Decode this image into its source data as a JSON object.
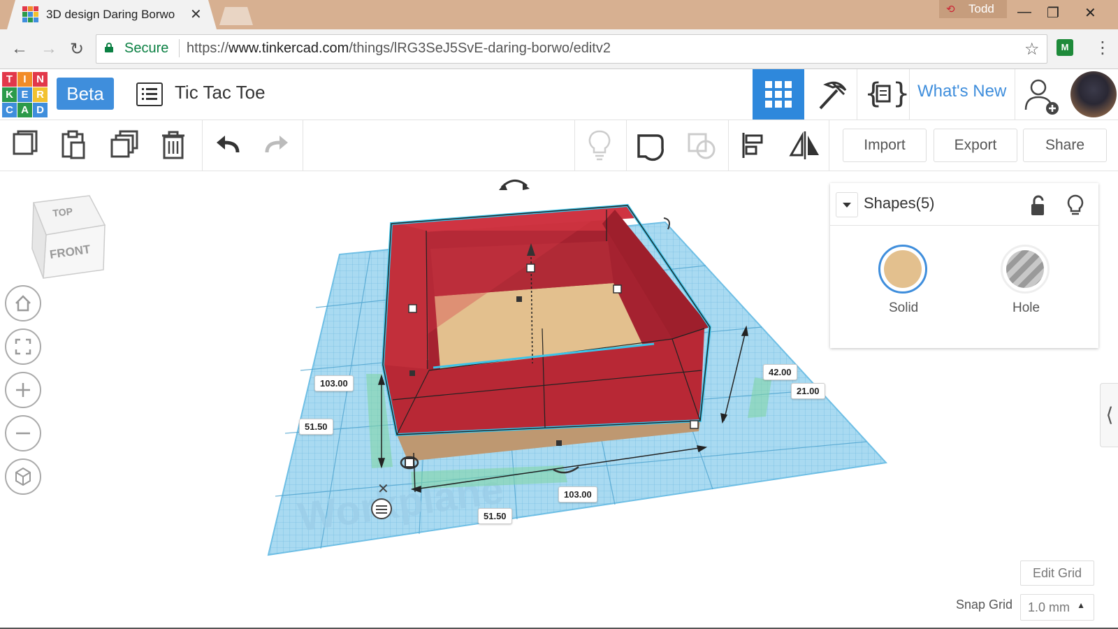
{
  "browser": {
    "tab_title": "3D design Daring Borwo",
    "tab_close": "✕",
    "profile_name": "Todd",
    "window_controls": {
      "minimize": "—",
      "restore": "❐",
      "close": "✕"
    },
    "secure_label": "Secure",
    "url_prefix": "https://",
    "url_host": "www.tinkercad.com",
    "url_path": "/things/lRG3SeJ5SvE-daring-borwo/editv2"
  },
  "app": {
    "logo_letters": [
      "T",
      "I",
      "N",
      "K",
      "E",
      "R",
      "C",
      "A",
      "D"
    ],
    "beta_label": "Beta",
    "design_title": "Tic Tac Toe",
    "whats_new": "What's New"
  },
  "toolbar": {
    "import_label": "Import",
    "export_label": "Export",
    "share_label": "Share"
  },
  "viewcube": {
    "top": "TOP",
    "front": "FRONT"
  },
  "panel": {
    "title": "Shapes(5)",
    "solid_label": "Solid",
    "hole_label": "Hole",
    "solid_color": "#e3c08e"
  },
  "canvas": {
    "workplane_label": "Workplane",
    "dimensions": {
      "height_left": "103.00",
      "offset_left": "51.50",
      "height_right": "42.00",
      "elev_right": "21.00",
      "width_bottom": "103.00",
      "offset_bottom": "51.50"
    }
  },
  "footer": {
    "edit_grid": "Edit Grid",
    "snap_grid_label": "Snap Grid",
    "snap_grid_value": "1.0 mm"
  },
  "colors": {
    "accent": "#3f8edc",
    "box_red": "#c8303c",
    "grid_blue": "#7fc3e6"
  }
}
